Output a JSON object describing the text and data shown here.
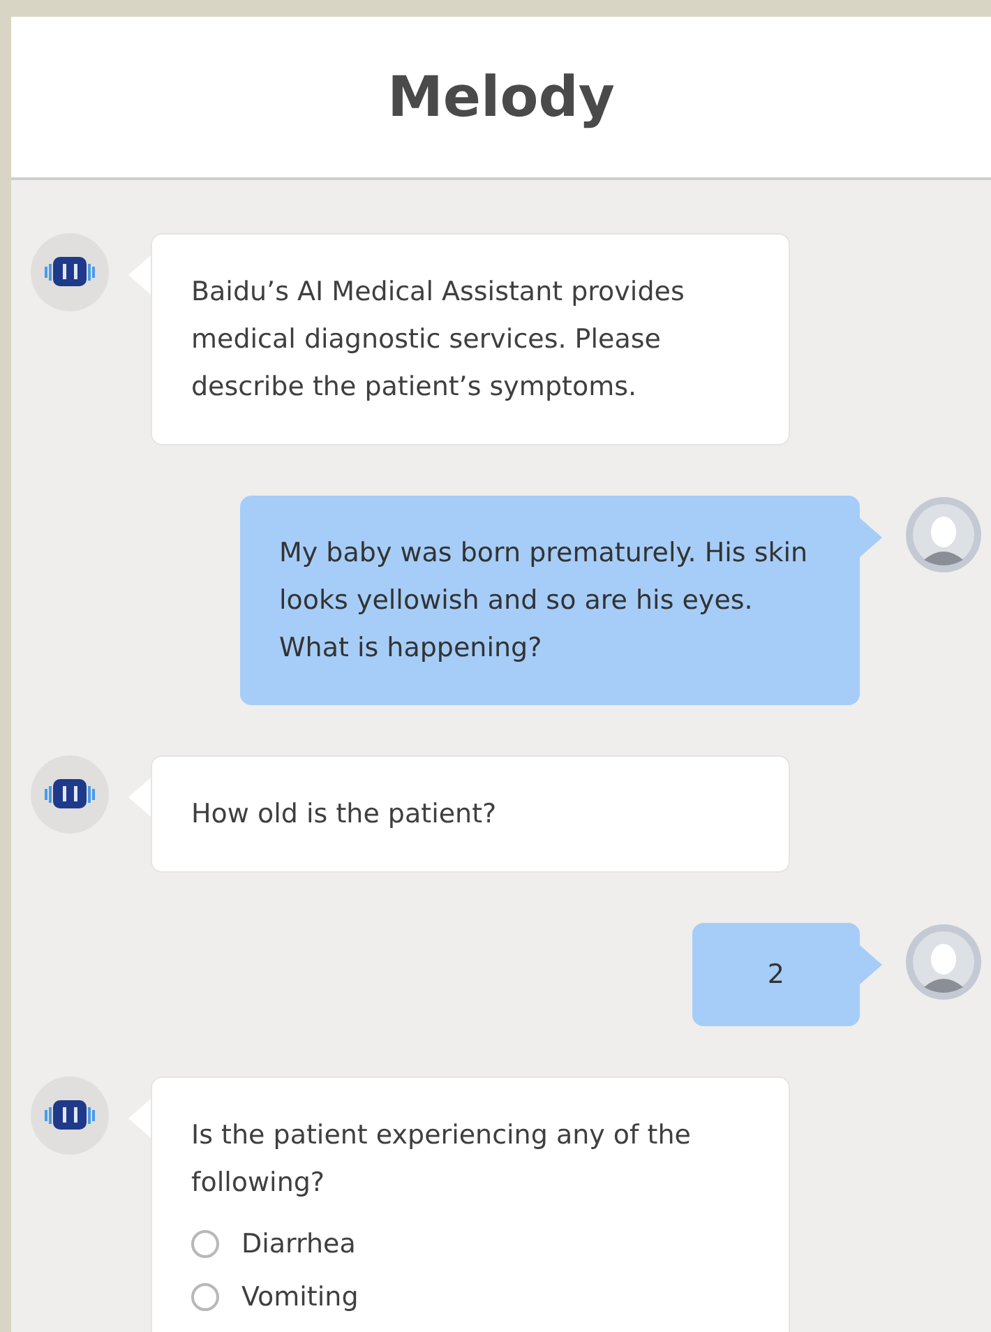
{
  "header": {
    "title": "Melody"
  },
  "messages": [
    {
      "kind": "bot",
      "text": "Baidu’s AI Medical Assistant provides medical diagnostic services. Please describe the patient’s symptoms."
    },
    {
      "kind": "user",
      "text": "My baby was born prematurely. His skin looks yellowish and so are his eyes. What is happening?"
    },
    {
      "kind": "bot",
      "text": "How old is the patient?"
    },
    {
      "kind": "user",
      "text": "2"
    },
    {
      "kind": "bot",
      "text": "Is the patient experiencing any of the following?",
      "options": [
        {
          "label": "Diarrhea",
          "selected": false
        },
        {
          "label": "Vomiting",
          "selected": false
        }
      ]
    }
  ]
}
